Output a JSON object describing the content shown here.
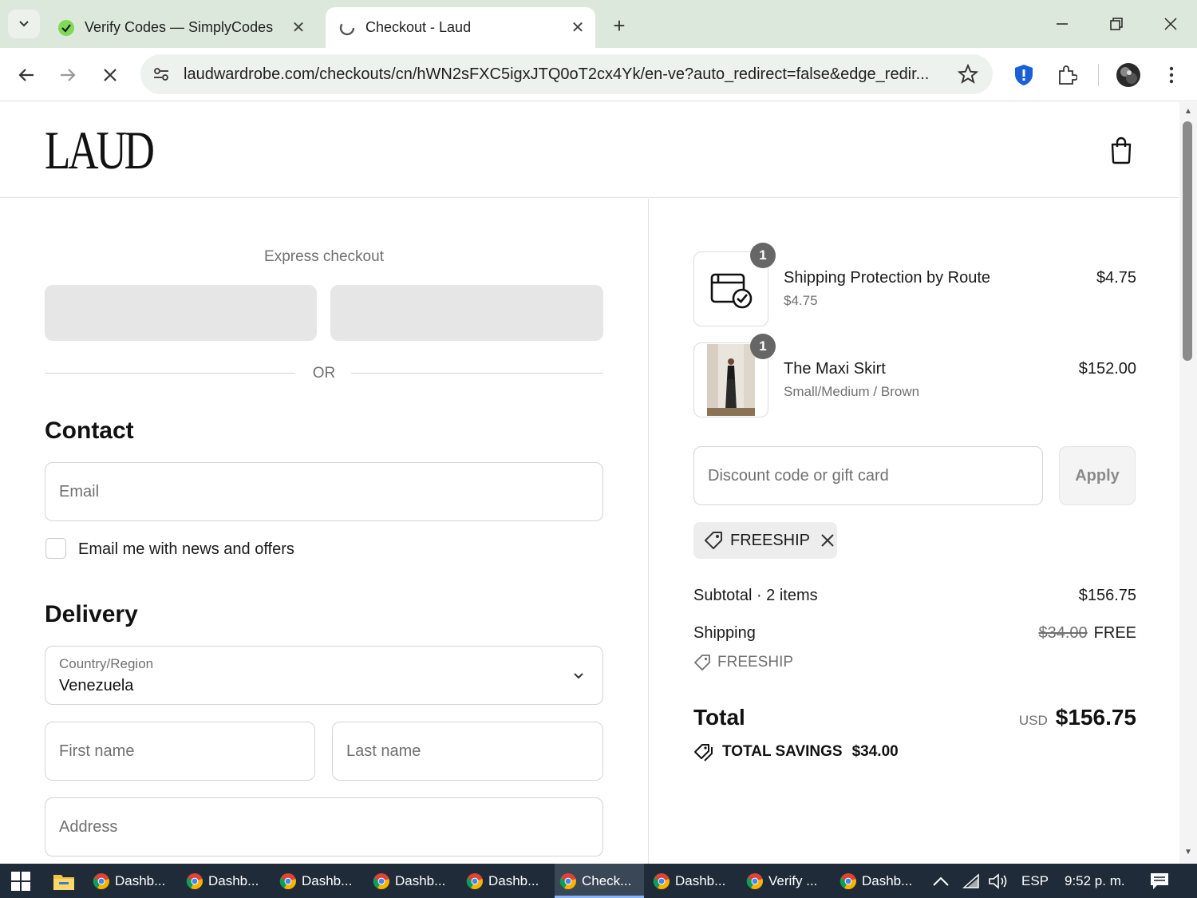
{
  "browser": {
    "tabs": [
      {
        "title": "Verify Codes — SimplyCodes",
        "active": false,
        "favicon": "simplycodes-icon"
      },
      {
        "title": "Checkout - Laud",
        "active": true,
        "favicon": "loading-icon"
      }
    ],
    "url": "laudwardrobe.com/checkouts/cn/hWN2sFXC5igxJTQ0oT2cx4Yk/en-ve?auto_redirect=false&edge_redir..."
  },
  "site": {
    "logo": "LAUD"
  },
  "express": {
    "title": "Express checkout",
    "or": "OR"
  },
  "contact": {
    "title": "Contact",
    "email_placeholder": "Email",
    "newsletter_label": "Email me with news and offers"
  },
  "delivery": {
    "title": "Delivery",
    "country_label": "Country/Region",
    "country_value": "Venezuela",
    "first_name_placeholder": "First name",
    "last_name_placeholder": "Last name",
    "address_placeholder": "Address"
  },
  "order": {
    "items": [
      {
        "qty": "1",
        "name": "Shipping Protection by Route",
        "sub": "$4.75",
        "price": "$4.75"
      },
      {
        "qty": "1",
        "name": "The Maxi Skirt",
        "sub": "Small/Medium / Brown",
        "price": "$152.00"
      }
    ],
    "discount_placeholder": "Discount code or gift card",
    "apply_label": "Apply",
    "applied_code": "FREESHIP",
    "subtotal_label": "Subtotal · 2 items",
    "subtotal_value": "$156.75",
    "shipping_label": "Shipping",
    "shipping_original": "$34.00",
    "shipping_value": "FREE",
    "shipping_code": "FREESHIP",
    "total_label": "Total",
    "currency": "USD",
    "total_value": "$156.75",
    "savings_label": "TOTAL SAVINGS",
    "savings_value": "$34.00"
  },
  "taskbar": {
    "items": [
      {
        "label": "Dashb...",
        "active": false
      },
      {
        "label": "Dashb...",
        "active": false
      },
      {
        "label": "Dashb...",
        "active": false
      },
      {
        "label": "Dashb...",
        "active": false
      },
      {
        "label": "Dashb...",
        "active": false
      },
      {
        "label": "Check...",
        "active": true
      },
      {
        "label": "Dashb...",
        "active": false
      },
      {
        "label": "Verify ...",
        "active": false
      },
      {
        "label": "Dashb...",
        "active": false
      }
    ],
    "language": "ESP",
    "time": "9:52 p. m."
  },
  "colors": {
    "tabbar": "#dde8dd",
    "taskbar": "#1f2b38",
    "accent": "#1a73e8"
  }
}
